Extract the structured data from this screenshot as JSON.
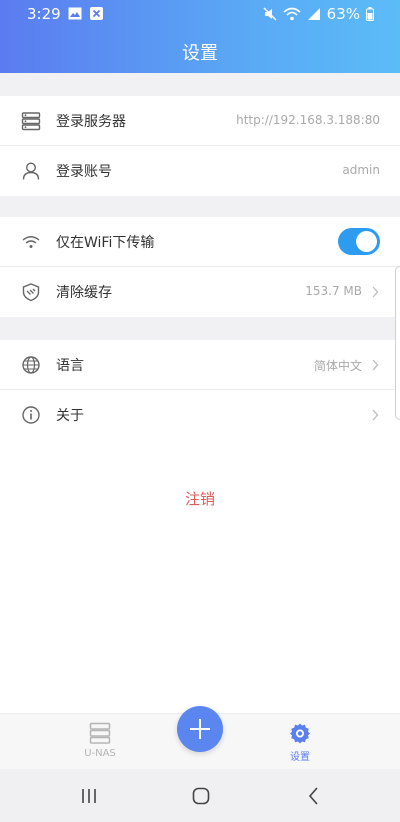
{
  "status": {
    "time": "3:29",
    "battery": "63%",
    "icons_left": [
      "image-icon",
      "close-box-icon"
    ],
    "icons_right": [
      "mute-icon",
      "wifi-icon",
      "signal-icon",
      "battery-icon"
    ]
  },
  "header": {
    "title": "设置"
  },
  "group1": [
    {
      "label": "登录服务器",
      "value": "http://192.168.3.188:80",
      "icon": "server-icon"
    },
    {
      "label": "登录账号",
      "value": "admin",
      "icon": "user-icon"
    }
  ],
  "group2": [
    {
      "label": "仅在WiFi下传输",
      "icon": "wifi-icon",
      "toggle_on": true
    },
    {
      "label": "清除缓存",
      "value": "153.7 MB",
      "icon": "cache-icon"
    }
  ],
  "group3": [
    {
      "label": "语言",
      "value": "简体中文",
      "icon": "globe-icon"
    },
    {
      "label": "关于",
      "value": "",
      "icon": "info-icon"
    }
  ],
  "logout_label": "注销",
  "tabbar": {
    "tabs": [
      {
        "label": "U-NAS",
        "icon": "storage-icon",
        "active": false
      },
      {
        "label": "设置",
        "icon": "gear-icon",
        "active": true
      }
    ],
    "fab_icon": "plus-icon"
  },
  "colors": {
    "accent": "#5b86f0",
    "toggle": "#2d9cf0",
    "logout": "#e05b5b"
  }
}
